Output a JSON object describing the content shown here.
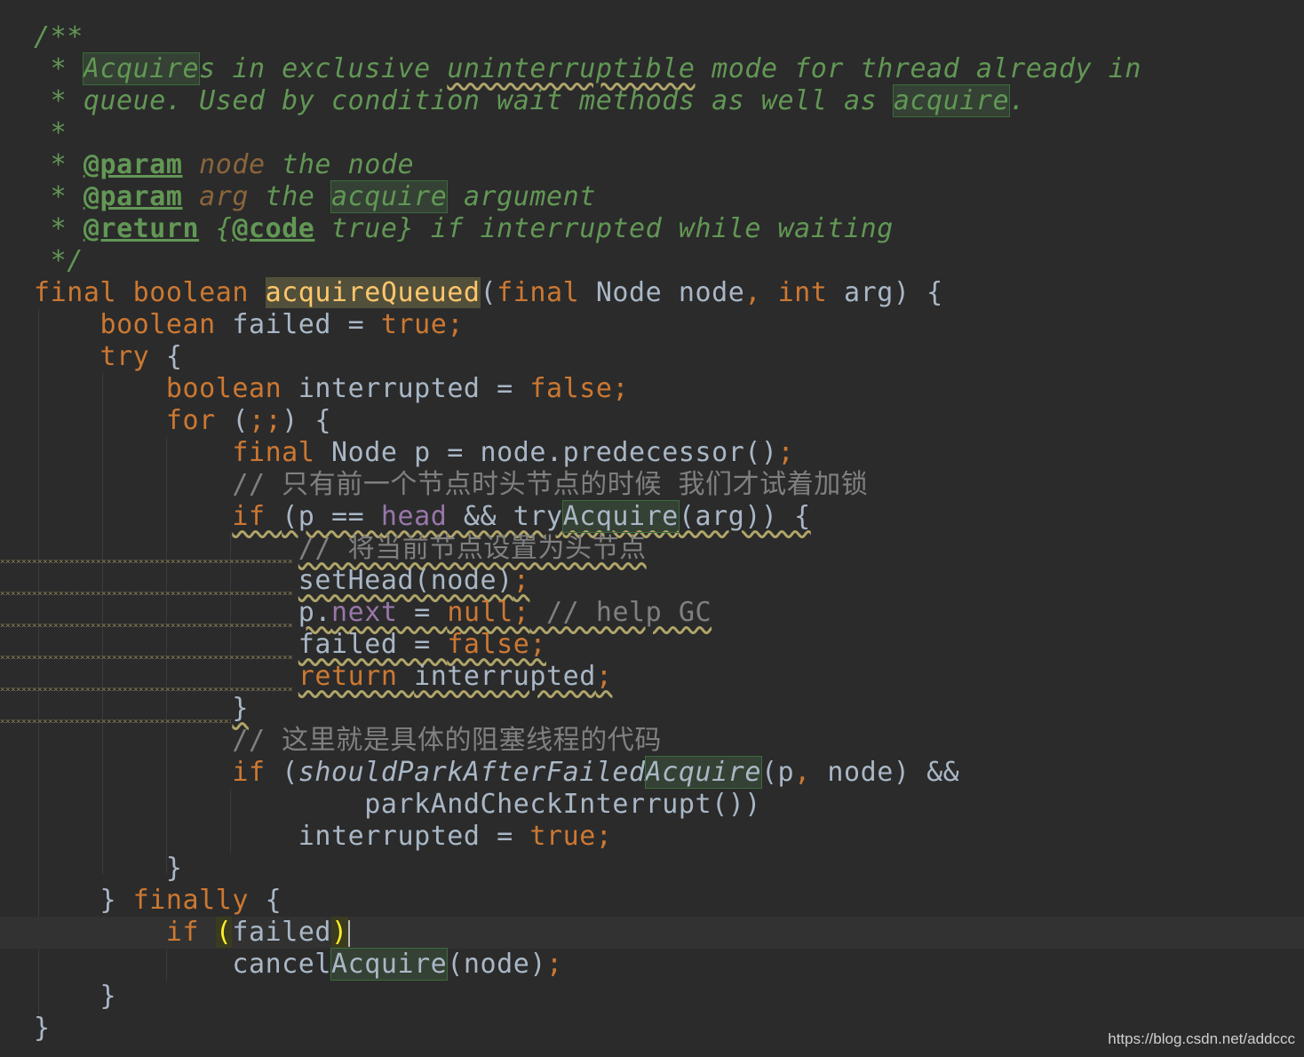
{
  "editor": {
    "language": "java",
    "colors": {
      "background": "#2b2b2b",
      "keyword": "#cc7832",
      "doc_comment": "#629755",
      "comment": "#808080",
      "field": "#9876aa",
      "method_decl": "#ffc66d",
      "default_text": "#a9b7c6"
    },
    "lines": [
      {
        "tokens": [
          {
            "t": "/**",
            "c": "doc"
          }
        ]
      },
      {
        "tokens": [
          {
            "t": " * ",
            "c": "doc"
          },
          {
            "t": "Acquire",
            "c": "doc hl-green"
          },
          {
            "t": "s in exclusive ",
            "c": "doc"
          },
          {
            "t": "uninterruptible",
            "c": "doc wavy"
          },
          {
            "t": " mode for thread already in",
            "c": "doc"
          }
        ]
      },
      {
        "tokens": [
          {
            "t": " * queue. Used by condition wait methods as well as ",
            "c": "doc"
          },
          {
            "t": "acquire",
            "c": "doc hl-green"
          },
          {
            "t": ".",
            "c": "doc"
          }
        ]
      },
      {
        "tokens": [
          {
            "t": " *",
            "c": "doc"
          }
        ]
      },
      {
        "tokens": [
          {
            "t": " * ",
            "c": "doc"
          },
          {
            "t": "@param",
            "c": "tag"
          },
          {
            "t": " ",
            "c": "doc"
          },
          {
            "t": "node",
            "c": "param"
          },
          {
            "t": " the node",
            "c": "doc"
          }
        ]
      },
      {
        "tokens": [
          {
            "t": " * ",
            "c": "doc"
          },
          {
            "t": "@param",
            "c": "tag"
          },
          {
            "t": " ",
            "c": "doc"
          },
          {
            "t": "arg",
            "c": "param"
          },
          {
            "t": " the ",
            "c": "doc"
          },
          {
            "t": "acquire",
            "c": "doc hl-green"
          },
          {
            "t": " argument",
            "c": "doc"
          }
        ]
      },
      {
        "tokens": [
          {
            "t": " * ",
            "c": "doc"
          },
          {
            "t": "@return",
            "c": "tag"
          },
          {
            "t": " {",
            "c": "doc"
          },
          {
            "t": "@code",
            "c": "tag"
          },
          {
            "t": " true} if interrupted while waiting",
            "c": "doc"
          }
        ]
      },
      {
        "tokens": [
          {
            "t": " */",
            "c": "doc"
          }
        ]
      },
      {
        "tokens": [
          {
            "t": "final boolean ",
            "c": "kw"
          },
          {
            "t": "acquire",
            "c": "hl-method"
          },
          {
            "t": "Queued",
            "c": "hl-method"
          },
          {
            "t": "(",
            "c": ""
          },
          {
            "t": "final ",
            "c": "kw"
          },
          {
            "t": "Node node",
            "c": ""
          },
          {
            "t": ", ",
            "c": "kw"
          },
          {
            "t": "int ",
            "c": "kw"
          },
          {
            "t": "arg) {",
            "c": ""
          }
        ]
      },
      {
        "tokens": [
          {
            "t": "    ",
            "c": ""
          },
          {
            "t": "boolean ",
            "c": "kw"
          },
          {
            "t": "failed = ",
            "c": ""
          },
          {
            "t": "true;",
            "c": "kw"
          }
        ]
      },
      {
        "tokens": [
          {
            "t": "    ",
            "c": ""
          },
          {
            "t": "try ",
            "c": "kw"
          },
          {
            "t": "{",
            "c": ""
          }
        ]
      },
      {
        "tokens": [
          {
            "t": "        ",
            "c": ""
          },
          {
            "t": "boolean ",
            "c": "kw"
          },
          {
            "t": "interrupted = ",
            "c": ""
          },
          {
            "t": "false;",
            "c": "kw"
          }
        ]
      },
      {
        "tokens": [
          {
            "t": "        ",
            "c": ""
          },
          {
            "t": "for ",
            "c": "kw"
          },
          {
            "t": "(",
            "c": ""
          },
          {
            "t": ";;",
            "c": "kw"
          },
          {
            "t": ") {",
            "c": ""
          }
        ]
      },
      {
        "tokens": [
          {
            "t": "            ",
            "c": ""
          },
          {
            "t": "final ",
            "c": "kw"
          },
          {
            "t": "Node p = node.predecessor()",
            "c": ""
          },
          {
            "t": ";",
            "c": "kw"
          }
        ]
      },
      {
        "tokens": [
          {
            "t": "            ",
            "c": ""
          },
          {
            "t": "// 只有前一个节点时头节点的时候 我们才试着加锁",
            "c": "cmt"
          }
        ]
      },
      {
        "tokens": [
          {
            "t": "            ",
            "c": ""
          },
          {
            "t": "if ",
            "c": "kw wavy"
          },
          {
            "t": "(p == ",
            "c": "wavy"
          },
          {
            "t": "head",
            "c": "fld wavy"
          },
          {
            "t": " && try",
            "c": "wavy"
          },
          {
            "t": "Acquire",
            "c": "hl-green wavy"
          },
          {
            "t": "(arg)) {",
            "c": "wavy"
          }
        ]
      },
      {
        "tokens": [
          {
            "t": "                ",
            "c": ""
          },
          {
            "t": "// 将当前节点设置为头节点",
            "c": "cmt wavy"
          }
        ]
      },
      {
        "tokens": [
          {
            "t": "                ",
            "c": ""
          },
          {
            "t": "setHead(node)",
            "c": "wavy"
          },
          {
            "t": ";",
            "c": "kw wavy"
          }
        ]
      },
      {
        "tokens": [
          {
            "t": "                ",
            "c": ""
          },
          {
            "t": "p.",
            "c": "wavy"
          },
          {
            "t": "next",
            "c": "fld wavy"
          },
          {
            "t": " = ",
            "c": "wavy"
          },
          {
            "t": "null;",
            "c": "kw wavy"
          },
          {
            "t": " // help GC",
            "c": "cmt wavy"
          }
        ]
      },
      {
        "tokens": [
          {
            "t": "                ",
            "c": ""
          },
          {
            "t": "failed = ",
            "c": "wavy"
          },
          {
            "t": "false;",
            "c": "kw wavy"
          }
        ]
      },
      {
        "tokens": [
          {
            "t": "                ",
            "c": ""
          },
          {
            "t": "return ",
            "c": "kw wavy"
          },
          {
            "t": "interrupted",
            "c": "wavy"
          },
          {
            "t": ";",
            "c": "kw wavy"
          }
        ]
      },
      {
        "tokens": [
          {
            "t": "            ",
            "c": ""
          },
          {
            "t": "}",
            "c": "wavy"
          }
        ]
      },
      {
        "tokens": [
          {
            "t": "            ",
            "c": ""
          },
          {
            "t": "// 这里就是具体的阻塞线程的代码",
            "c": "cmt"
          }
        ]
      },
      {
        "tokens": [
          {
            "t": "            ",
            "c": ""
          },
          {
            "t": "if ",
            "c": "kw"
          },
          {
            "t": "(",
            "c": ""
          },
          {
            "t": "shouldParkAfterFailed",
            "c": "ital"
          },
          {
            "t": "Acquire",
            "c": "ital hl-green"
          },
          {
            "t": "(p",
            "c": ""
          },
          {
            "t": ", ",
            "c": "kw"
          },
          {
            "t": "node) &&",
            "c": ""
          }
        ]
      },
      {
        "tokens": [
          {
            "t": "                    ",
            "c": ""
          },
          {
            "t": "parkAndCheckInterrupt())",
            "c": ""
          }
        ]
      },
      {
        "tokens": [
          {
            "t": "                ",
            "c": ""
          },
          {
            "t": "interrupted = ",
            "c": ""
          },
          {
            "t": "true;",
            "c": "kw"
          }
        ]
      },
      {
        "tokens": [
          {
            "t": "        ",
            "c": ""
          },
          {
            "t": "}",
            "c": ""
          }
        ]
      },
      {
        "tokens": [
          {
            "t": "    } ",
            "c": ""
          },
          {
            "t": "finally ",
            "c": "kw"
          },
          {
            "t": "{",
            "c": ""
          }
        ]
      },
      {
        "tokens": [
          {
            "t": "        ",
            "c": ""
          },
          {
            "t": "if ",
            "c": "kw"
          },
          {
            "t": "(",
            "c": "hl-yellow"
          },
          {
            "t": "failed",
            "c": ""
          },
          {
            "t": ")",
            "c": "hl-yellow"
          }
        ],
        "caret": true
      },
      {
        "tokens": [
          {
            "t": "            ",
            "c": ""
          },
          {
            "t": "cancel",
            "c": ""
          },
          {
            "t": "Acquire",
            "c": "hl-green"
          },
          {
            "t": "(node)",
            "c": ""
          },
          {
            "t": ";",
            "c": "kw"
          }
        ]
      },
      {
        "tokens": [
          {
            "t": "    ",
            "c": ""
          },
          {
            "t": "}",
            "c": ""
          }
        ]
      },
      {
        "tokens": [
          {
            "t": "}",
            "c": ""
          }
        ]
      }
    ]
  },
  "watermark": "https://blog.csdn.net/addccc"
}
